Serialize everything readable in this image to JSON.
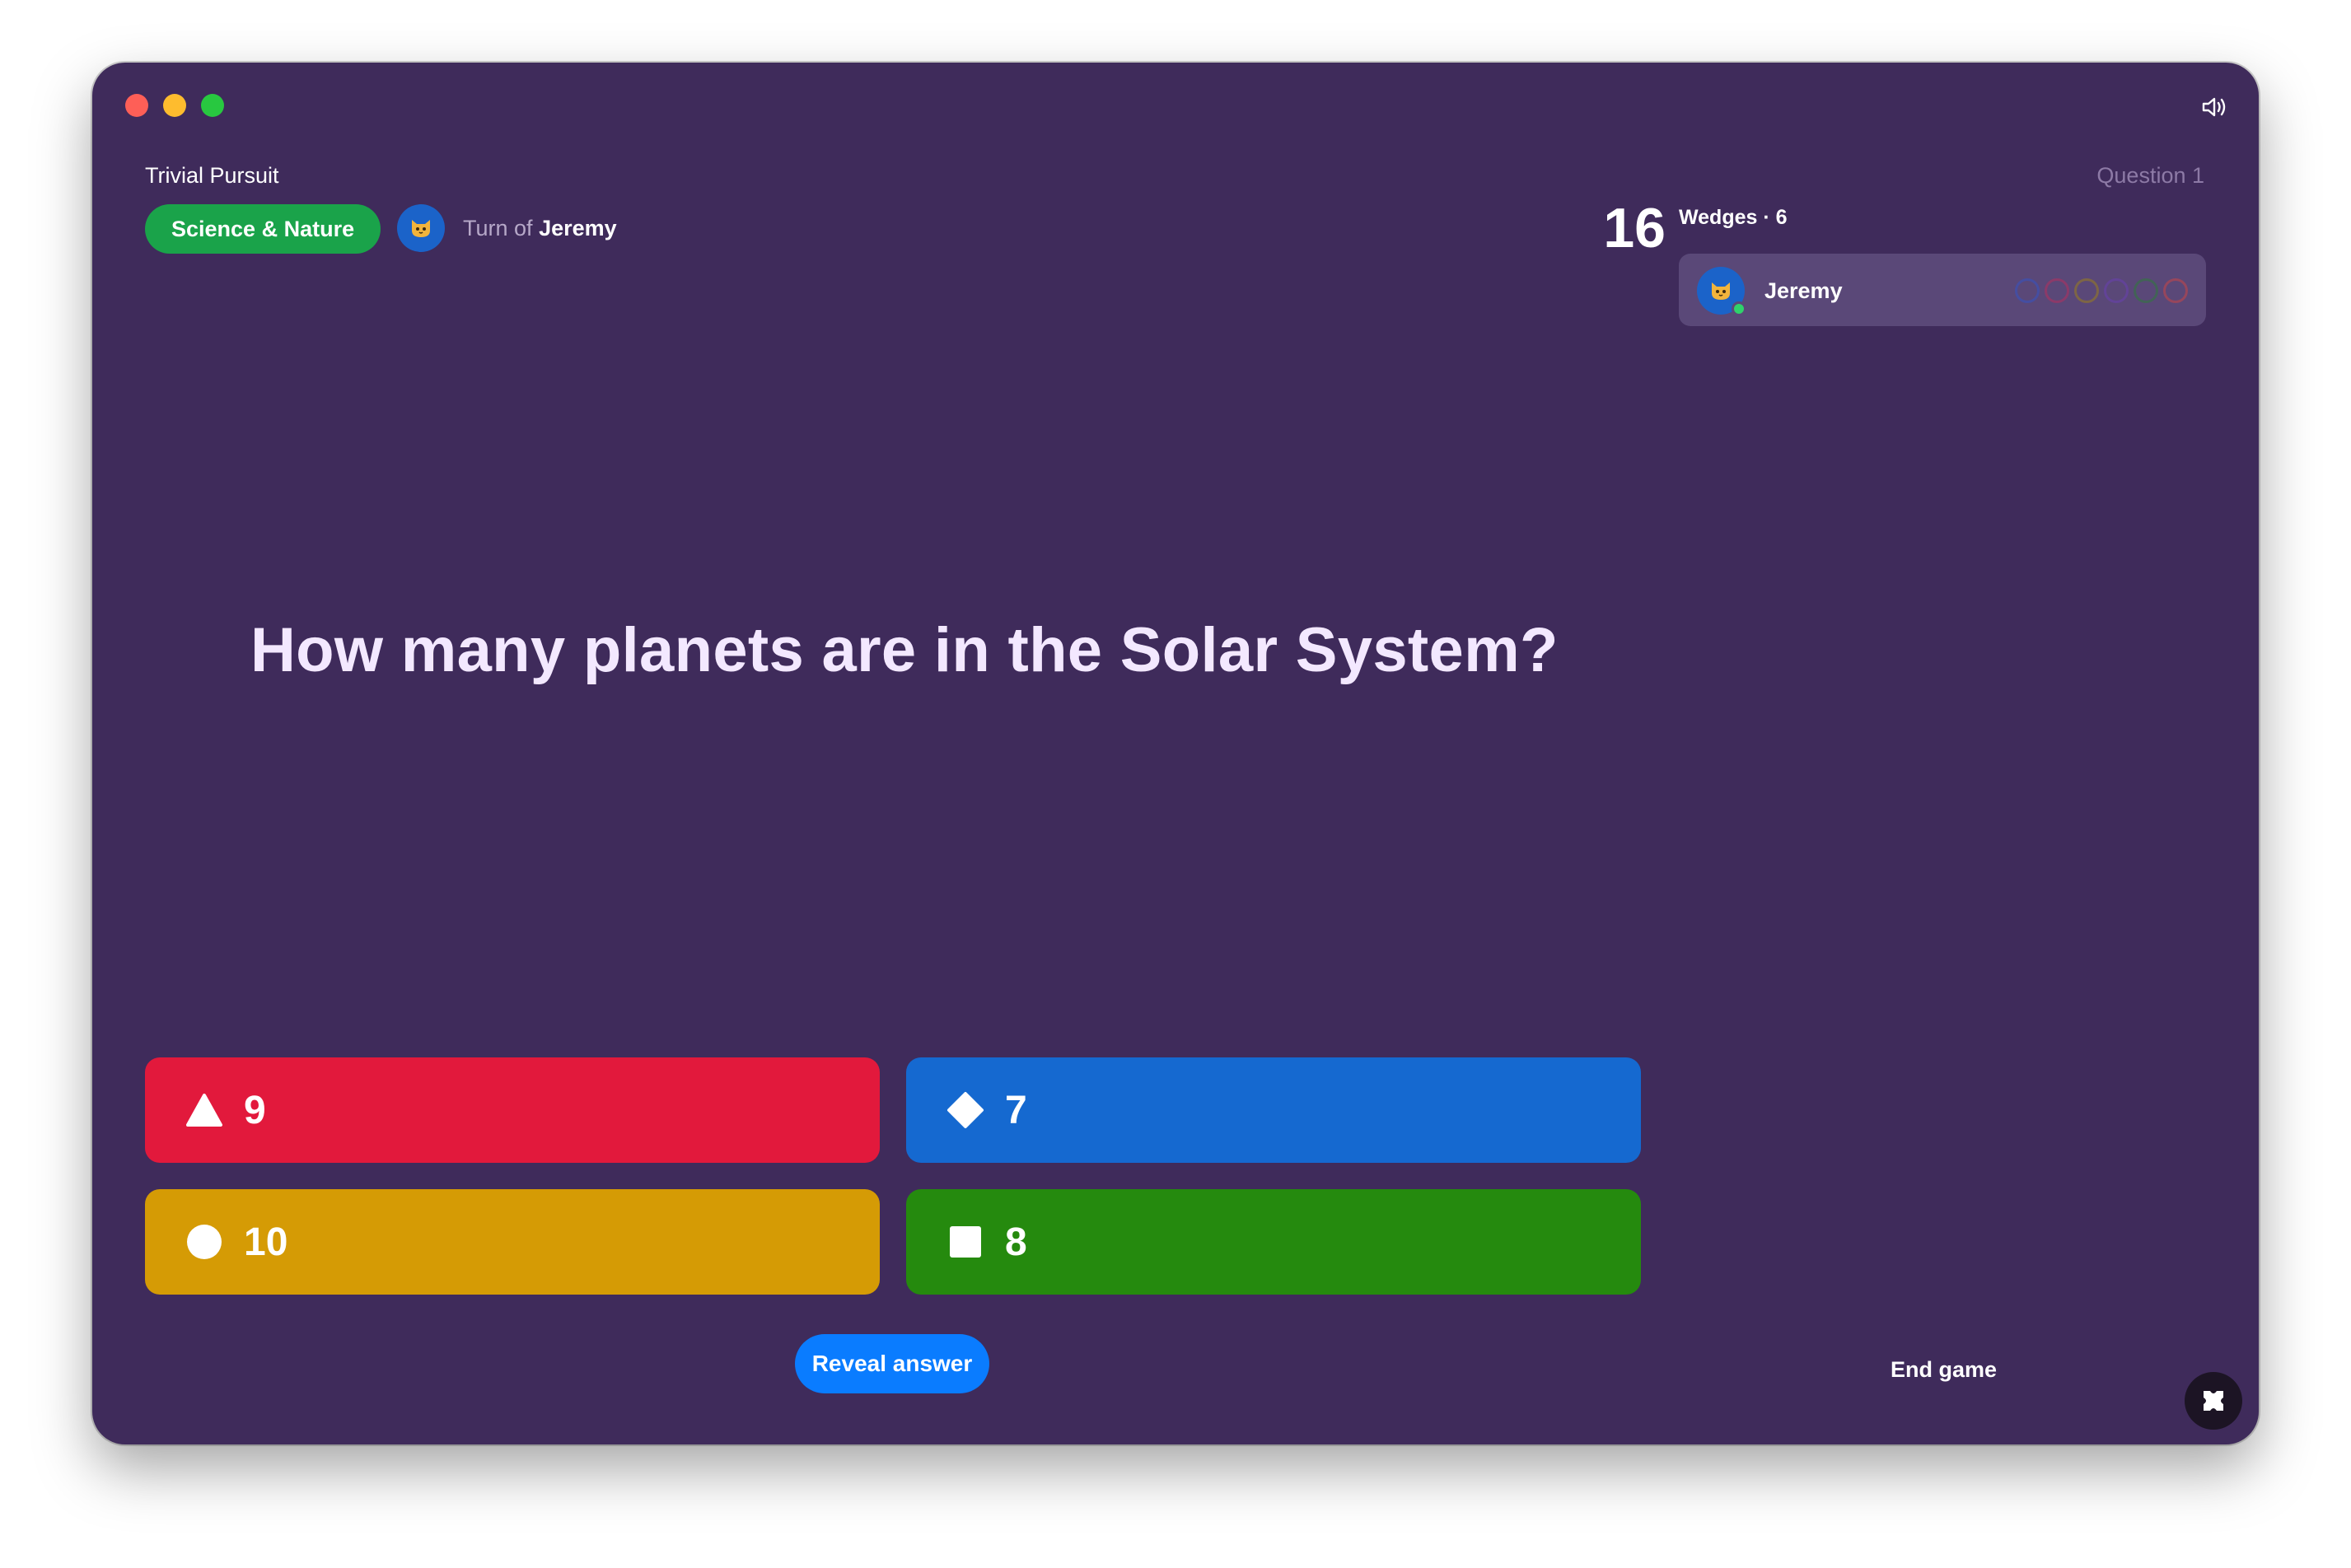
{
  "window": {
    "traffic_colors": [
      "#fe5f57",
      "#febc2e",
      "#28c840"
    ]
  },
  "header": {
    "app_title": "Trivial Pursuit",
    "question_label": "Question 1",
    "category": "Science & Nature",
    "category_color": "#1aa34a",
    "turn_prefix": "Turn of",
    "turn_player": "Jeremy",
    "avatar_icon": "cat-face-icon"
  },
  "timer": {
    "seconds": "16"
  },
  "wedges": {
    "title": "Wedges · 6",
    "player": {
      "name": "Jeremy",
      "status": "online",
      "avatar_icon": "cat-face-icon",
      "slot_colors": [
        "#3454c2",
        "#b5305d",
        "#9a7d1c",
        "#6a3fb0",
        "#2f7a3b",
        "#c94646"
      ]
    }
  },
  "question": {
    "text": "How many planets are in the Solar System?"
  },
  "answers": [
    {
      "shape": "triangle-icon",
      "label": "9",
      "color": "#e2193c"
    },
    {
      "shape": "diamond-icon",
      "label": "7",
      "color": "#1569d0"
    },
    {
      "shape": "circle-icon",
      "label": "10",
      "color": "#d59b05"
    },
    {
      "shape": "square-icon",
      "label": "8",
      "color": "#258a0e"
    }
  ],
  "actions": {
    "reveal_label": "Reveal answer",
    "reveal_color": "#0a7cff",
    "end_game_label": "End game"
  },
  "icons": {
    "sound": "speaker-icon",
    "corner": "app-menu-icon"
  }
}
